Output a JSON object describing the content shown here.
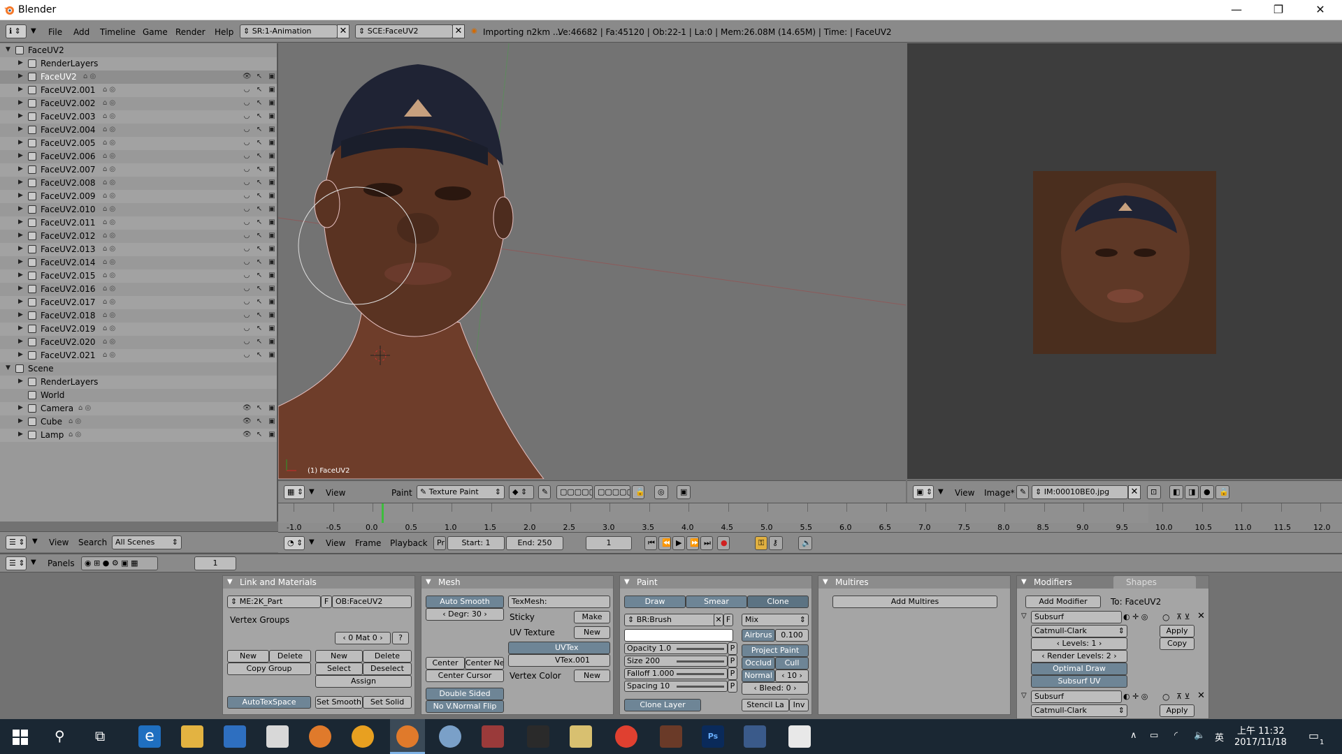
{
  "window": {
    "title": "Blender"
  },
  "infoheader": {
    "menus": [
      "File",
      "Add",
      "Timeline",
      "Game",
      "Render",
      "Help"
    ],
    "screen": "SR:1-Animation",
    "scene": "SCE:FaceUV2",
    "status": "Importing n2km ...",
    "stats": "Ve:46682 | Fa:45120 | Ob:22-1 | La:0 | Mem:26.08M (14.65M) | Time: | FaceUV2"
  },
  "outliner": {
    "items": [
      {
        "label": "FaceUV2"
      },
      {
        "label": "RenderLayers"
      },
      {
        "label": "FaceUV2"
      },
      {
        "label": "FaceUV2.001"
      },
      {
        "label": "FaceUV2.002"
      },
      {
        "label": "FaceUV2.003"
      },
      {
        "label": "FaceUV2.004"
      },
      {
        "label": "FaceUV2.005"
      },
      {
        "label": "FaceUV2.006"
      },
      {
        "label": "FaceUV2.007"
      },
      {
        "label": "FaceUV2.008"
      },
      {
        "label": "FaceUV2.009"
      },
      {
        "label": "FaceUV2.010"
      },
      {
        "label": "FaceUV2.011"
      },
      {
        "label": "FaceUV2.012"
      },
      {
        "label": "FaceUV2.013"
      },
      {
        "label": "FaceUV2.014"
      },
      {
        "label": "FaceUV2.015"
      },
      {
        "label": "FaceUV2.016"
      },
      {
        "label": "FaceUV2.017"
      },
      {
        "label": "FaceUV2.018"
      },
      {
        "label": "FaceUV2.019"
      },
      {
        "label": "FaceUV2.020"
      },
      {
        "label": "FaceUV2.021"
      },
      {
        "label": "Scene"
      },
      {
        "label": "RenderLayers"
      },
      {
        "label": "World"
      },
      {
        "label": "Camera"
      },
      {
        "label": "Cube"
      },
      {
        "label": "Lamp"
      }
    ],
    "footer": {
      "view": "View",
      "search": "Search",
      "scope": "All Scenes"
    }
  },
  "viewport": {
    "object_label": "(1) FaceUV2",
    "header": {
      "view": "View",
      "paint": "Paint",
      "mode": "Texture Paint"
    }
  },
  "imageeditor": {
    "header": {
      "view": "View",
      "image": "Image*",
      "image_name": "IM:00010BE0.jpg"
    }
  },
  "timeline": {
    "ticks": [
      "-1.0",
      "-0.5",
      "0.0",
      "0.5",
      "1.0",
      "1.5",
      "2.0",
      "2.5",
      "3.0",
      "3.5",
      "4.0",
      "4.5",
      "5.0",
      "5.5",
      "6.0",
      "6.5",
      "7.0",
      "7.5",
      "8.0",
      "8.5",
      "9.0",
      "9.5",
      "10.0",
      "10.5",
      "11.0",
      "11.5",
      "12.0"
    ],
    "header": {
      "view": "View",
      "frame": "Frame",
      "playback": "Playback",
      "pr": "Pr",
      "start": "Start: 1",
      "end": "End: 250",
      "current": "1"
    }
  },
  "buttons_header": {
    "panels": "Panels",
    "frame": "1"
  },
  "panels": {
    "link": {
      "title": "Link and Materials",
      "me": "ME:2K_Part",
      "f": "F",
      "ob": "OB:FaceUV2",
      "vertex_groups": "Vertex Groups",
      "mat": "0 Mat 0",
      "q": "?",
      "new1": "New",
      "delete1": "Delete",
      "copy_group": "Copy Group",
      "new2": "New",
      "delete2": "Delete",
      "select": "Select",
      "deselect": "Deselect",
      "assign": "Assign",
      "autotex": "AutoTexSpace",
      "set_smooth": "Set Smooth",
      "set_solid": "Set Solid"
    },
    "mesh": {
      "title": "Mesh",
      "auto_smooth": "Auto Smooth",
      "degr": "Degr: 30",
      "texmesh": "TexMesh:",
      "sticky": "Sticky",
      "make": "Make",
      "uv_texture": "UV Texture",
      "new_uv": "New",
      "uvtex": "UVTex",
      "vtex": "VTex.001",
      "center": "Center",
      "center_new": "Center New",
      "center_cursor": "Center Cursor",
      "vertex_color": "Vertex Color",
      "new_vc": "New",
      "double_sided": "Double Sided",
      "no_vnormal": "No V.Normal Flip"
    },
    "paint": {
      "title": "Paint",
      "draw": "Draw",
      "smear": "Smear",
      "clone": "Clone",
      "brush": "BR:Brush",
      "f": "F",
      "mix": "Mix",
      "airbrus": "Airbrus",
      "airbrus_val": "0.100",
      "opacity": "Opacity 1.0",
      "size": "Size 200",
      "falloff": "Falloff 1.000",
      "spacing": "Spacing 10",
      "p": "P",
      "project_paint": "Project Paint",
      "occlud": "Occlud",
      "cull": "Cull",
      "normal": "Normal",
      "normal_val": "10",
      "bleed": "Bleed: 0",
      "clone_layer": "Clone Layer",
      "stencil": "Stencil La",
      "inv": "Inv"
    },
    "multires": {
      "title": "Multires",
      "add": "Add Multires"
    },
    "modifiers": {
      "tab1": "Modifiers",
      "tab2": "Shapes",
      "add": "Add Modifier",
      "to": "To: FaceUV2",
      "mod1": "Subsurf",
      "type": "Catmull-Clark",
      "levels": "Levels: 1",
      "render_levels": "Render Levels: 2",
      "optimal": "Optimal Draw",
      "subsurf_uv": "Subsurf UV",
      "apply": "Apply",
      "copy": "Copy",
      "mod2": "Subsurf",
      "type2": "Catmull-Clark",
      "apply2": "Apply"
    }
  },
  "taskbar": {
    "time": "上午 11:32",
    "date": "2017/11/18",
    "lang": "英",
    "notify": "1"
  }
}
